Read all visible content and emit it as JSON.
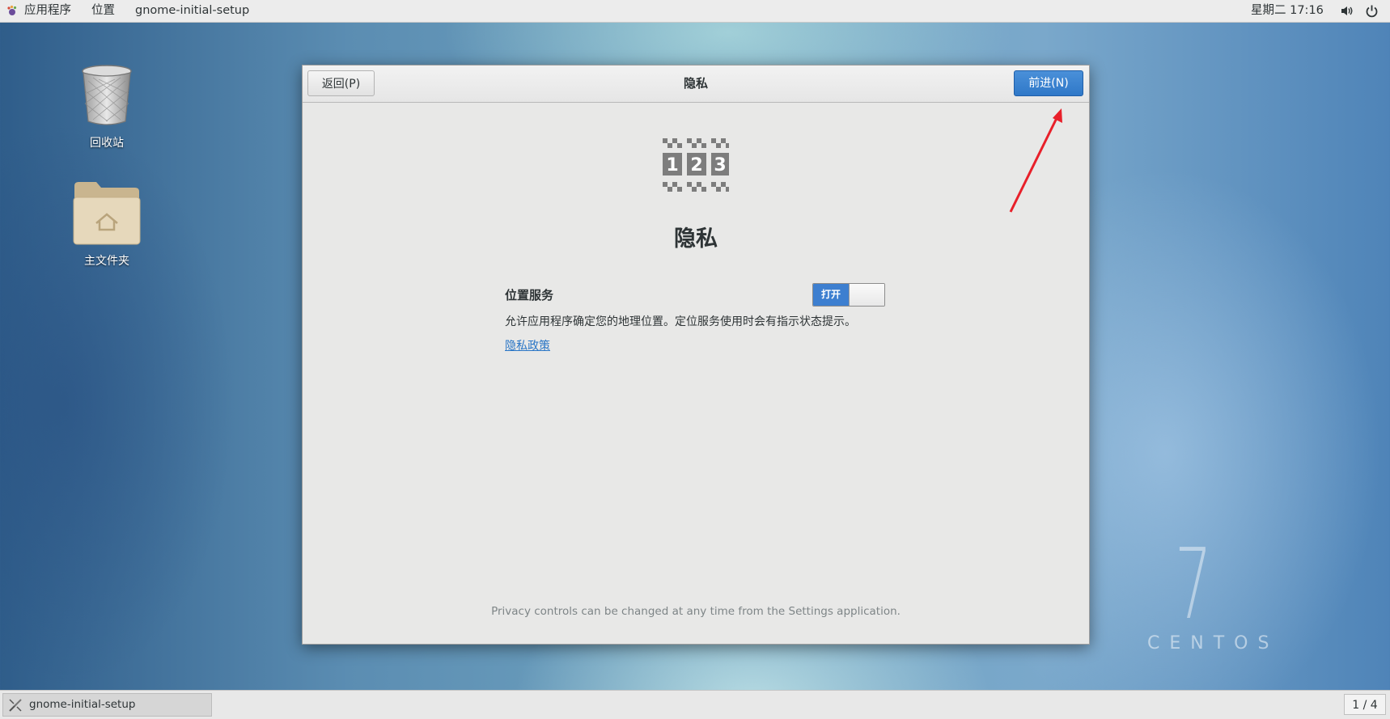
{
  "topbar": {
    "apps_menu": "应用程序",
    "places_menu": "位置",
    "app_name": "gnome-initial-setup",
    "clock": "星期二 17:16"
  },
  "desktop": {
    "trash_label": "回收站",
    "home_label": "主文件夹"
  },
  "window": {
    "back_label": "返回(P)",
    "next_label": "前进(N)",
    "title": "隐私",
    "page_heading": "隐私",
    "setting_label": "位置服务",
    "toggle_label": "打开",
    "toggle_on": true,
    "description": "允许应用程序确定您的地理位置。定位服务使用时会有指示状态提示。",
    "policy_link": "隐私政策",
    "footer": "Privacy controls can be changed at any time from the Settings application."
  },
  "taskbar": {
    "task_label": "gnome-initial-setup",
    "pager": "1 / 4"
  },
  "watermark": {
    "version": "7",
    "brand": "CENTOS"
  },
  "colors": {
    "accent": "#3d7fd0",
    "link": "#2a76c6",
    "annotation_arrow": "#e8202a"
  },
  "icons": [
    "foot-icon",
    "volume-icon",
    "power-icon",
    "trash-icon",
    "home-folder-icon",
    "privacy-icon",
    "setup-tool-icon"
  ]
}
